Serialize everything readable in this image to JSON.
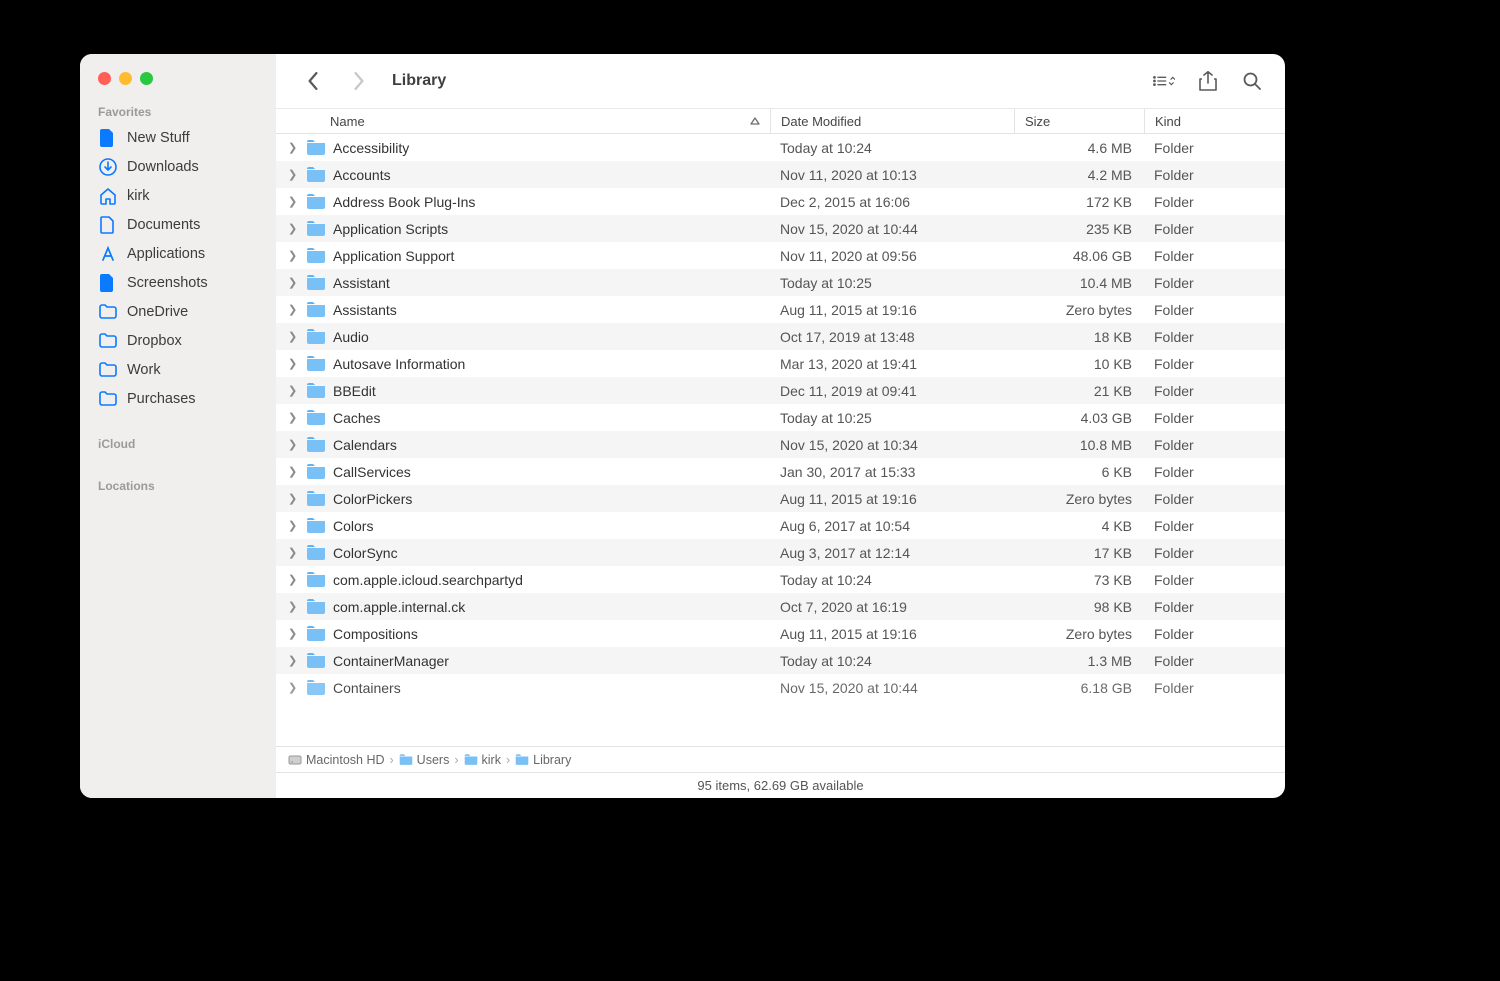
{
  "window": {
    "title": "Library"
  },
  "sidebar": {
    "sections": [
      {
        "heading": "Favorites",
        "items": [
          {
            "icon": "doc-fill",
            "label": "New Stuff"
          },
          {
            "icon": "download-circle",
            "label": "Downloads"
          },
          {
            "icon": "house",
            "label": "kirk"
          },
          {
            "icon": "doc",
            "label": "Documents"
          },
          {
            "icon": "app-a",
            "label": "Applications"
          },
          {
            "icon": "doc-fill",
            "label": "Screenshots"
          },
          {
            "icon": "folder",
            "label": "OneDrive"
          },
          {
            "icon": "folder",
            "label": "Dropbox"
          },
          {
            "icon": "folder",
            "label": "Work"
          },
          {
            "icon": "folder",
            "label": "Purchases"
          }
        ]
      },
      {
        "heading": "iCloud",
        "items": []
      },
      {
        "heading": "Locations",
        "items": []
      }
    ]
  },
  "columns": {
    "name": "Name",
    "date": "Date Modified",
    "size": "Size",
    "kind": "Kind"
  },
  "rows": [
    {
      "name": "Accessibility",
      "date": "Today at 10:24",
      "size": "4.6 MB",
      "kind": "Folder"
    },
    {
      "name": "Accounts",
      "date": "Nov 11, 2020 at 10:13",
      "size": "4.2 MB",
      "kind": "Folder"
    },
    {
      "name": "Address Book Plug-Ins",
      "date": "Dec 2, 2015 at 16:06",
      "size": "172 KB",
      "kind": "Folder"
    },
    {
      "name": "Application Scripts",
      "date": "Nov 15, 2020 at 10:44",
      "size": "235 KB",
      "kind": "Folder"
    },
    {
      "name": "Application Support",
      "date": "Nov 11, 2020 at 09:56",
      "size": "48.06 GB",
      "kind": "Folder"
    },
    {
      "name": "Assistant",
      "date": "Today at 10:25",
      "size": "10.4 MB",
      "kind": "Folder"
    },
    {
      "name": "Assistants",
      "date": "Aug 11, 2015 at 19:16",
      "size": "Zero bytes",
      "kind": "Folder"
    },
    {
      "name": "Audio",
      "date": "Oct 17, 2019 at 13:48",
      "size": "18 KB",
      "kind": "Folder"
    },
    {
      "name": "Autosave Information",
      "date": "Mar 13, 2020 at 19:41",
      "size": "10 KB",
      "kind": "Folder"
    },
    {
      "name": "BBEdit",
      "date": "Dec 11, 2019 at 09:41",
      "size": "21 KB",
      "kind": "Folder"
    },
    {
      "name": "Caches",
      "date": "Today at 10:25",
      "size": "4.03 GB",
      "kind": "Folder"
    },
    {
      "name": "Calendars",
      "date": "Nov 15, 2020 at 10:34",
      "size": "10.8 MB",
      "kind": "Folder"
    },
    {
      "name": "CallServices",
      "date": "Jan 30, 2017 at 15:33",
      "size": "6 KB",
      "kind": "Folder"
    },
    {
      "name": "ColorPickers",
      "date": "Aug 11, 2015 at 19:16",
      "size": "Zero bytes",
      "kind": "Folder"
    },
    {
      "name": "Colors",
      "date": "Aug 6, 2017 at 10:54",
      "size": "4 KB",
      "kind": "Folder"
    },
    {
      "name": "ColorSync",
      "date": "Aug 3, 2017 at 12:14",
      "size": "17 KB",
      "kind": "Folder"
    },
    {
      "name": "com.apple.icloud.searchpartyd",
      "date": "Today at 10:24",
      "size": "73 KB",
      "kind": "Folder"
    },
    {
      "name": "com.apple.internal.ck",
      "date": "Oct 7, 2020 at 16:19",
      "size": "98 KB",
      "kind": "Folder"
    },
    {
      "name": "Compositions",
      "date": "Aug 11, 2015 at 19:16",
      "size": "Zero bytes",
      "kind": "Folder"
    },
    {
      "name": "ContainerManager",
      "date": "Today at 10:24",
      "size": "1.3 MB",
      "kind": "Folder"
    },
    {
      "name": "Containers",
      "date": "Nov 15, 2020 at 10:44",
      "size": "6.18 GB",
      "kind": "Folder"
    }
  ],
  "path": [
    {
      "icon": "disk",
      "label": "Macintosh HD"
    },
    {
      "icon": "folder",
      "label": "Users"
    },
    {
      "icon": "folder",
      "label": "kirk"
    },
    {
      "icon": "folder",
      "label": "Library"
    }
  ],
  "status": "95 items, 62.69 GB available"
}
